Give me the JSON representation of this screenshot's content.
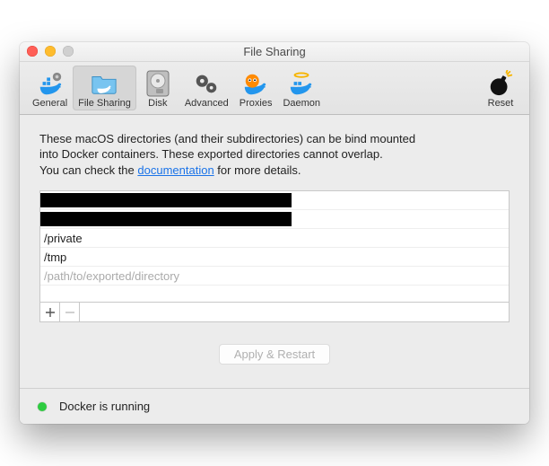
{
  "window": {
    "title": "File Sharing"
  },
  "toolbar": {
    "items": [
      {
        "label": "General"
      },
      {
        "label": "File Sharing"
      },
      {
        "label": "Disk"
      },
      {
        "label": "Advanced"
      },
      {
        "label": "Proxies"
      },
      {
        "label": "Daemon"
      }
    ],
    "reset": {
      "label": "Reset"
    }
  },
  "content": {
    "desc_line1": "These macOS directories (and their subdirectories) can be bind mounted",
    "desc_line2_a": "into Docker containers. These exported directories cannot overlap.",
    "desc_line3_a": "You can check the ",
    "desc_link": "documentation",
    "desc_line3_b": " for more details.",
    "paths": {
      "row0": "",
      "row1": "",
      "row2": "/private",
      "row3": "/tmp",
      "placeholder": "/path/to/exported/directory"
    },
    "apply_label": "Apply & Restart"
  },
  "status": {
    "text": "Docker is running"
  }
}
